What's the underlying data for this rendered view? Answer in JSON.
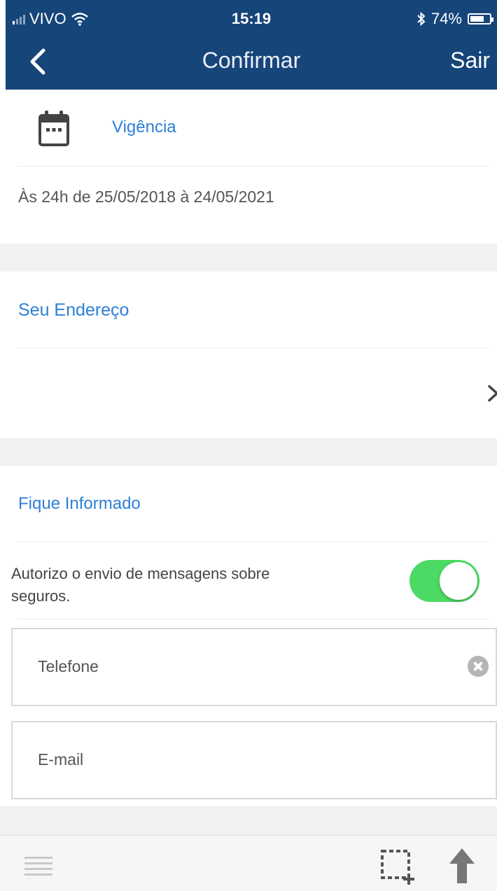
{
  "status_bar": {
    "carrier": "VIVO",
    "time": "15:19",
    "battery": "74%",
    "battery_level": 0.74
  },
  "nav": {
    "title": "Confirmar",
    "exit_label": "Sair"
  },
  "vigencia": {
    "title": "Vigência",
    "text": "Às 24h de 25/05/2018 à 24/05/2021"
  },
  "endereco": {
    "title": "Seu Endereço"
  },
  "fique": {
    "title": "Fique Informado",
    "consent_text": "Autorizo o envio de mensagens sobre seguros.",
    "consent_on": true
  },
  "fields": {
    "phone_placeholder": "Telefone",
    "email_placeholder": "E-mail"
  },
  "colors": {
    "header": "#16457a",
    "accent": "#2d7fd8",
    "toggle_on": "#4cd964"
  }
}
